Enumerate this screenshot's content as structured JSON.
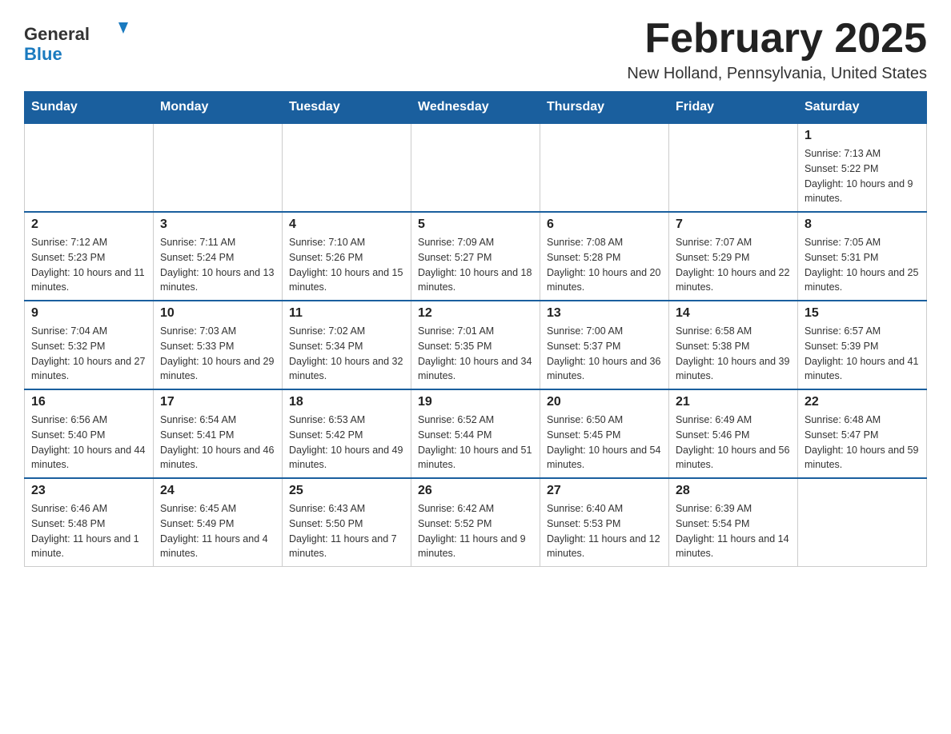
{
  "header": {
    "logo_general": "General",
    "logo_blue": "Blue",
    "month_title": "February 2025",
    "location": "New Holland, Pennsylvania, United States"
  },
  "days_of_week": [
    "Sunday",
    "Monday",
    "Tuesday",
    "Wednesday",
    "Thursday",
    "Friday",
    "Saturday"
  ],
  "weeks": [
    [
      {
        "day": "",
        "info": ""
      },
      {
        "day": "",
        "info": ""
      },
      {
        "day": "",
        "info": ""
      },
      {
        "day": "",
        "info": ""
      },
      {
        "day": "",
        "info": ""
      },
      {
        "day": "",
        "info": ""
      },
      {
        "day": "1",
        "info": "Sunrise: 7:13 AM\nSunset: 5:22 PM\nDaylight: 10 hours and 9 minutes."
      }
    ],
    [
      {
        "day": "2",
        "info": "Sunrise: 7:12 AM\nSunset: 5:23 PM\nDaylight: 10 hours and 11 minutes."
      },
      {
        "day": "3",
        "info": "Sunrise: 7:11 AM\nSunset: 5:24 PM\nDaylight: 10 hours and 13 minutes."
      },
      {
        "day": "4",
        "info": "Sunrise: 7:10 AM\nSunset: 5:26 PM\nDaylight: 10 hours and 15 minutes."
      },
      {
        "day": "5",
        "info": "Sunrise: 7:09 AM\nSunset: 5:27 PM\nDaylight: 10 hours and 18 minutes."
      },
      {
        "day": "6",
        "info": "Sunrise: 7:08 AM\nSunset: 5:28 PM\nDaylight: 10 hours and 20 minutes."
      },
      {
        "day": "7",
        "info": "Sunrise: 7:07 AM\nSunset: 5:29 PM\nDaylight: 10 hours and 22 minutes."
      },
      {
        "day": "8",
        "info": "Sunrise: 7:05 AM\nSunset: 5:31 PM\nDaylight: 10 hours and 25 minutes."
      }
    ],
    [
      {
        "day": "9",
        "info": "Sunrise: 7:04 AM\nSunset: 5:32 PM\nDaylight: 10 hours and 27 minutes."
      },
      {
        "day": "10",
        "info": "Sunrise: 7:03 AM\nSunset: 5:33 PM\nDaylight: 10 hours and 29 minutes."
      },
      {
        "day": "11",
        "info": "Sunrise: 7:02 AM\nSunset: 5:34 PM\nDaylight: 10 hours and 32 minutes."
      },
      {
        "day": "12",
        "info": "Sunrise: 7:01 AM\nSunset: 5:35 PM\nDaylight: 10 hours and 34 minutes."
      },
      {
        "day": "13",
        "info": "Sunrise: 7:00 AM\nSunset: 5:37 PM\nDaylight: 10 hours and 36 minutes."
      },
      {
        "day": "14",
        "info": "Sunrise: 6:58 AM\nSunset: 5:38 PM\nDaylight: 10 hours and 39 minutes."
      },
      {
        "day": "15",
        "info": "Sunrise: 6:57 AM\nSunset: 5:39 PM\nDaylight: 10 hours and 41 minutes."
      }
    ],
    [
      {
        "day": "16",
        "info": "Sunrise: 6:56 AM\nSunset: 5:40 PM\nDaylight: 10 hours and 44 minutes."
      },
      {
        "day": "17",
        "info": "Sunrise: 6:54 AM\nSunset: 5:41 PM\nDaylight: 10 hours and 46 minutes."
      },
      {
        "day": "18",
        "info": "Sunrise: 6:53 AM\nSunset: 5:42 PM\nDaylight: 10 hours and 49 minutes."
      },
      {
        "day": "19",
        "info": "Sunrise: 6:52 AM\nSunset: 5:44 PM\nDaylight: 10 hours and 51 minutes."
      },
      {
        "day": "20",
        "info": "Sunrise: 6:50 AM\nSunset: 5:45 PM\nDaylight: 10 hours and 54 minutes."
      },
      {
        "day": "21",
        "info": "Sunrise: 6:49 AM\nSunset: 5:46 PM\nDaylight: 10 hours and 56 minutes."
      },
      {
        "day": "22",
        "info": "Sunrise: 6:48 AM\nSunset: 5:47 PM\nDaylight: 10 hours and 59 minutes."
      }
    ],
    [
      {
        "day": "23",
        "info": "Sunrise: 6:46 AM\nSunset: 5:48 PM\nDaylight: 11 hours and 1 minute."
      },
      {
        "day": "24",
        "info": "Sunrise: 6:45 AM\nSunset: 5:49 PM\nDaylight: 11 hours and 4 minutes."
      },
      {
        "day": "25",
        "info": "Sunrise: 6:43 AM\nSunset: 5:50 PM\nDaylight: 11 hours and 7 minutes."
      },
      {
        "day": "26",
        "info": "Sunrise: 6:42 AM\nSunset: 5:52 PM\nDaylight: 11 hours and 9 minutes."
      },
      {
        "day": "27",
        "info": "Sunrise: 6:40 AM\nSunset: 5:53 PM\nDaylight: 11 hours and 12 minutes."
      },
      {
        "day": "28",
        "info": "Sunrise: 6:39 AM\nSunset: 5:54 PM\nDaylight: 11 hours and 14 minutes."
      },
      {
        "day": "",
        "info": ""
      }
    ]
  ]
}
